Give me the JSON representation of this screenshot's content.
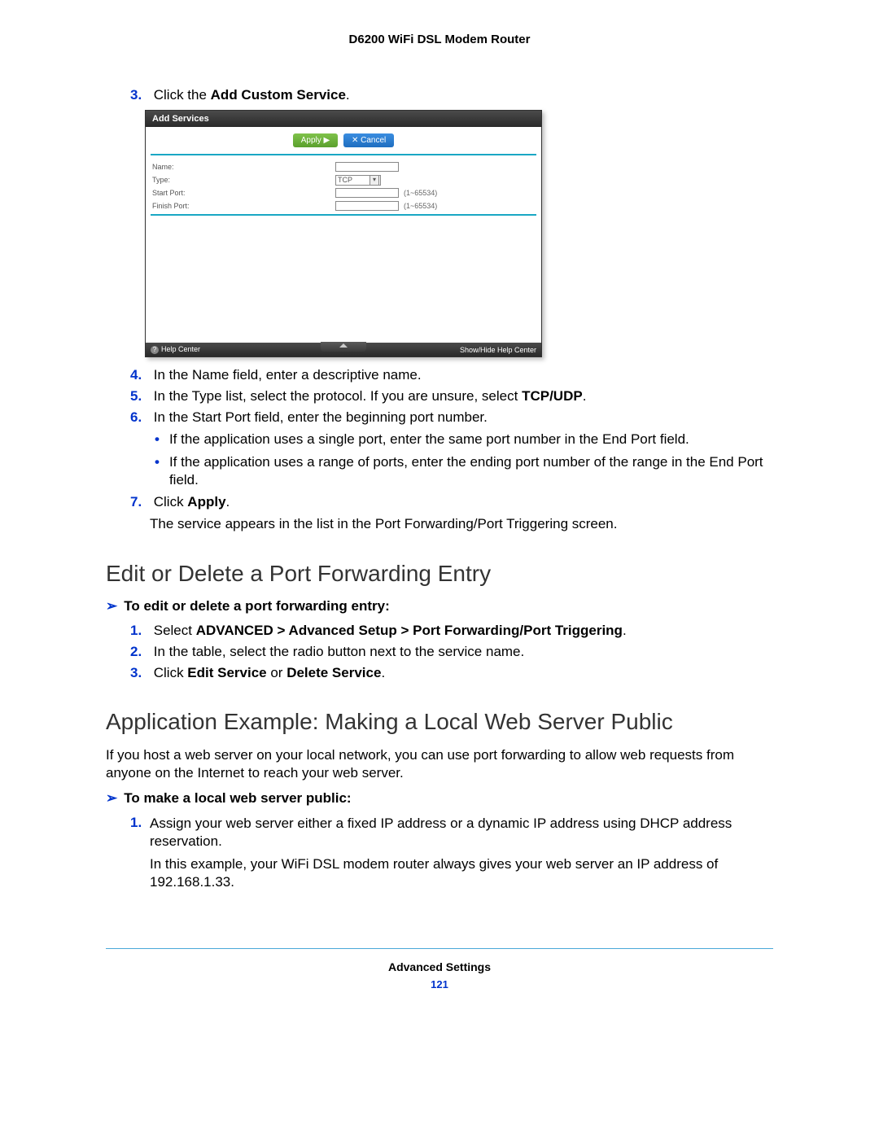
{
  "header": {
    "title": "D6200 WiFi DSL Modem Router"
  },
  "step3": {
    "num": "3.",
    "pre": "Click the ",
    "bold": "Add Custom Service",
    "post": "."
  },
  "shot": {
    "title": "Add Services",
    "apply": "Apply ▶",
    "cancel": "✕ Cancel",
    "rows": {
      "name": {
        "label": "Name:"
      },
      "type": {
        "label": "Type:",
        "value": "TCP"
      },
      "start": {
        "label": "Start Port:",
        "hint": "(1~65534)"
      },
      "finish": {
        "label": "Finish Port:",
        "hint": "(1~65534)"
      }
    },
    "footer": {
      "help": "Help Center",
      "toggle": "Show/Hide Help Center"
    }
  },
  "step4": {
    "num": "4.",
    "text": "In the Name field, enter a descriptive name."
  },
  "step5": {
    "num": "5.",
    "pre": "In the Type list, select the protocol. If you are unsure, select ",
    "bold": "TCP/UDP",
    "post": "."
  },
  "step6": {
    "num": "6.",
    "text": "In the Start Port field, enter the beginning port number."
  },
  "bullets6": [
    "If the application uses a single port, enter the same port number in the End Port field.",
    "If the application uses a range of ports, enter the ending port number of the range in the End Port field."
  ],
  "step7": {
    "num": "7.",
    "pre": "Click ",
    "bold": "Apply",
    "post": ".",
    "follow": "The service appears in the list in the Port Forwarding/Port Triggering screen."
  },
  "section_edit": {
    "heading": "Edit or Delete a Port Forwarding Entry",
    "task": "To edit or delete a port forwarding entry:",
    "s1": {
      "num": "1.",
      "pre": "Select ",
      "bold": "ADVANCED > Advanced Setup > Port Forwarding/Port Triggering",
      "post": "."
    },
    "s2": {
      "num": "2.",
      "text": "In the table, select the radio button next to the service name."
    },
    "s3": {
      "num": "3.",
      "pre": "Click ",
      "b1": "Edit Service",
      "mid": " or ",
      "b2": "Delete Service",
      "post": "."
    }
  },
  "section_app": {
    "heading": "Application Example: Making a Local Web Server Public",
    "intro": "If you host a web server on your local network, you can use port forwarding to allow web requests from anyone on the Internet to reach your web server.",
    "task": "To make a local web server public:",
    "s1": {
      "num": "1.",
      "text": "Assign your web server either a fixed IP address or a dynamic IP address using DHCP address reservation."
    },
    "s1_follow": "In this example, your WiFi DSL modem router always gives your web server an IP address of 192.168.1.33."
  },
  "footer": {
    "section": "Advanced Settings",
    "page": "121"
  }
}
